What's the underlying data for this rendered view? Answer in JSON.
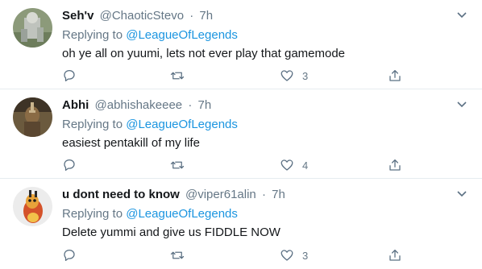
{
  "tweets": [
    {
      "name": "Seh'v",
      "handle": "@ChaoticStevo",
      "separator": "·",
      "time": "7h",
      "replying_prefix": "Replying to",
      "replying_to": "@LeagueOfLegends",
      "text": "oh ye all on yuumi, lets not ever play that gamemode",
      "like_count": "3"
    },
    {
      "name": "Abhi",
      "handle": "@abhishakeeee",
      "separator": "·",
      "time": "7h",
      "replying_prefix": "Replying to",
      "replying_to": "@LeagueOfLegends",
      "text": "easiest pentakill of my life",
      "like_count": "4"
    },
    {
      "name": "u dont need to know",
      "handle": "@viper61alin",
      "separator": "·",
      "time": "7h",
      "replying_prefix": "Replying to",
      "replying_to": "@LeagueOfLegends",
      "text": "Delete yummi and give us FIDDLE NOW",
      "like_count": "3"
    }
  ],
  "icons": {
    "reply": "reply-icon",
    "retweet": "retweet-icon",
    "like": "heart-icon",
    "share": "share-icon",
    "menu": "chevron-down-icon"
  },
  "colors": {
    "mention": "#1b95e0",
    "secondary": "#657786",
    "icon": "#5b7083",
    "divider": "#e6ecf0"
  }
}
